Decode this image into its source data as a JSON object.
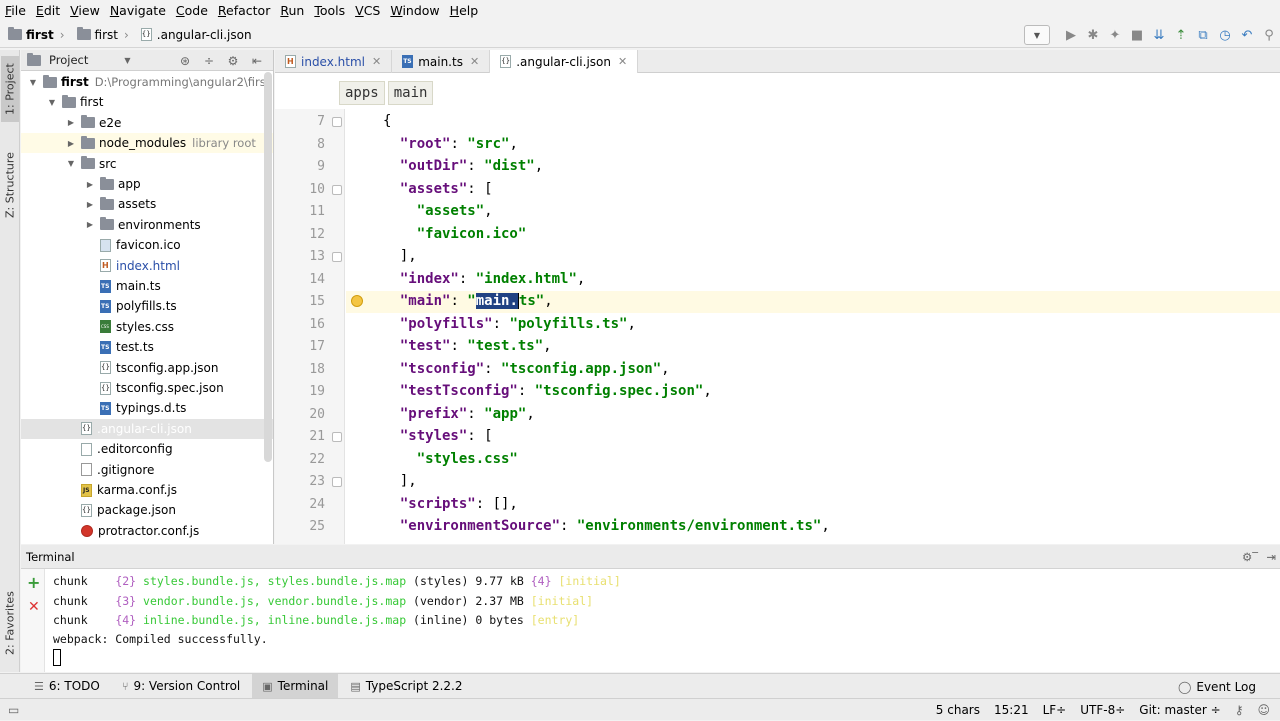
{
  "menu": [
    "File",
    "Edit",
    "View",
    "Navigate",
    "Code",
    "Refactor",
    "Run",
    "Tools",
    "VCS",
    "Window",
    "Help"
  ],
  "breadcrumbs": [
    "first",
    "first",
    ".angular-cli.json"
  ],
  "side_tabs": {
    "project": "1: Project",
    "structure": "Z: Structure",
    "favorites": "2: Favorites"
  },
  "project_panel": {
    "title": "Project",
    "tree": [
      {
        "label": "first",
        "path": "D:\\Programming\\angular2\\first",
        "depth": 0,
        "arrow": "open",
        "icon": "folder-icon",
        "bold": true
      },
      {
        "label": "first",
        "depth": 1,
        "arrow": "open",
        "icon": "folder-icon"
      },
      {
        "label": "e2e",
        "depth": 2,
        "arrow": "closed",
        "icon": "folder-icon"
      },
      {
        "label": "node_modules",
        "hint": "library root",
        "depth": 2,
        "arrow": "closed",
        "icon": "folder-icon",
        "hl": true
      },
      {
        "label": "src",
        "depth": 2,
        "arrow": "open",
        "icon": "folder-icon"
      },
      {
        "label": "app",
        "depth": 3,
        "arrow": "closed",
        "icon": "folder-icon"
      },
      {
        "label": "assets",
        "depth": 3,
        "arrow": "closed",
        "icon": "folder-icon"
      },
      {
        "label": "environments",
        "depth": 3,
        "arrow": "closed",
        "icon": "folder-icon"
      },
      {
        "label": "favicon.ico",
        "depth": 3,
        "icon": "ico"
      },
      {
        "label": "index.html",
        "depth": 3,
        "icon": "html",
        "blue": true
      },
      {
        "label": "main.ts",
        "depth": 3,
        "icon": "ts"
      },
      {
        "label": "polyfills.ts",
        "depth": 3,
        "icon": "ts"
      },
      {
        "label": "styles.css",
        "depth": 3,
        "icon": "css"
      },
      {
        "label": "test.ts",
        "depth": 3,
        "icon": "ts"
      },
      {
        "label": "tsconfig.app.json",
        "depth": 3,
        "icon": "json"
      },
      {
        "label": "tsconfig.spec.json",
        "depth": 3,
        "icon": "json"
      },
      {
        "label": "typings.d.ts",
        "depth": 3,
        "icon": "ts"
      },
      {
        "label": ".angular-cli.json",
        "depth": 2,
        "icon": "json",
        "selected": true
      },
      {
        "label": ".editorconfig",
        "depth": 2,
        "icon": "cfg"
      },
      {
        "label": ".gitignore",
        "depth": 2,
        "icon": "ign"
      },
      {
        "label": "karma.conf.js",
        "depth": 2,
        "icon": "js"
      },
      {
        "label": "package.json",
        "depth": 2,
        "icon": "json"
      },
      {
        "label": "protractor.conf.js",
        "depth": 2,
        "icon": "proj"
      }
    ]
  },
  "tabs": [
    {
      "label": "index.html",
      "icon": "html",
      "blue": true
    },
    {
      "label": "main.ts",
      "icon": "ts"
    },
    {
      "label": ".angular-cli.json",
      "icon": "json",
      "active": true
    }
  ],
  "editor": {
    "crumbs": [
      "apps",
      "main"
    ],
    "lines": [
      {
        "n": "7",
        "code": "{"
      },
      {
        "n": "8",
        "code": "  \"root\": \"src\","
      },
      {
        "n": "9",
        "code": "  \"outDir\": \"dist\","
      },
      {
        "n": "10",
        "code": "  \"assets\": ["
      },
      {
        "n": "11",
        "code": "    \"assets\","
      },
      {
        "n": "12",
        "code": "    \"favicon.ico\""
      },
      {
        "n": "13",
        "code": "  ],"
      },
      {
        "n": "14",
        "code": "  \"index\": \"index.html\","
      },
      {
        "n": "15",
        "code": "  \"main\": \"main.ts\","
      },
      {
        "n": "16",
        "code": "  \"polyfills\": \"polyfills.ts\","
      },
      {
        "n": "17",
        "code": "  \"test\": \"test.ts\","
      },
      {
        "n": "18",
        "code": "  \"tsconfig\": \"tsconfig.app.json\","
      },
      {
        "n": "19",
        "code": "  \"testTsconfig\": \"tsconfig.spec.json\","
      },
      {
        "n": "20",
        "code": "  \"prefix\": \"app\","
      },
      {
        "n": "21",
        "code": "  \"styles\": ["
      },
      {
        "n": "22",
        "code": "    \"styles.css\""
      },
      {
        "n": "23",
        "code": "  ],"
      },
      {
        "n": "24",
        "code": "  \"scripts\": [],"
      },
      {
        "n": "25",
        "code": "  \"environmentSource\": \"environments/environment.ts\","
      }
    ]
  },
  "terminal": {
    "title": "Terminal",
    "lines": [
      {
        "a": "chunk    ",
        "b": "{2} ",
        "c": "styles.bundle.js, styles.bundle.js.map",
        "d": " (styles) 9.77 kB ",
        "e": "{4}",
        "f": " ",
        "g": "[initial]"
      },
      {
        "a": "chunk    ",
        "b": "{3} ",
        "c": "vendor.bundle.js, vendor.bundle.js.map",
        "d": " (vendor) 2.37 MB ",
        "e": "",
        "f": "",
        "g": "[initial]"
      },
      {
        "a": "chunk    ",
        "b": "{4} ",
        "c": "inline.bundle.js, inline.bundle.js.map",
        "d": " (inline) 0 bytes ",
        "e": "",
        "f": "",
        "g": "[entry]"
      }
    ],
    "compiled": "webpack: Compiled successfully."
  },
  "bottom_tabs": [
    {
      "label": "6: TODO",
      "icon": "todo-icon"
    },
    {
      "label": "9: Version Control",
      "icon": "vcs-icon"
    },
    {
      "label": "Terminal",
      "icon": "terminal-icon",
      "active": true
    },
    {
      "label": "TypeScript 2.2.2",
      "icon": "typescript-icon"
    }
  ],
  "event_log": "Event Log",
  "status": {
    "chars": "5 chars",
    "pos": "15:21",
    "lf": "LF÷",
    "enc": "UTF-8÷",
    "git": "Git: master ÷"
  }
}
